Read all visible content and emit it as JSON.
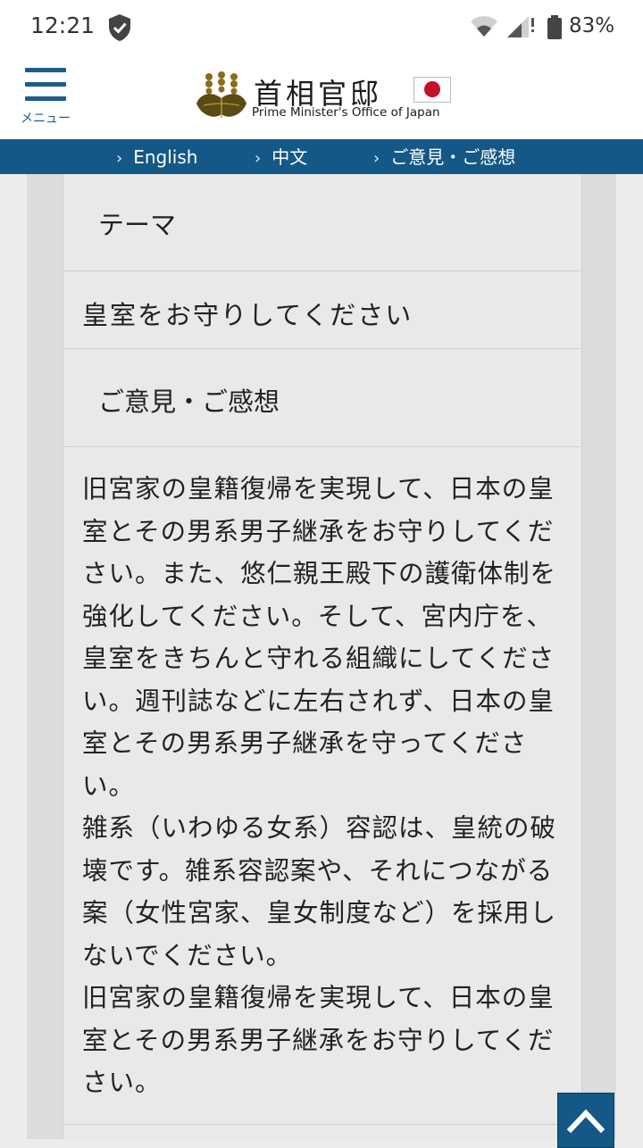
{
  "status_bar": {
    "time": "12:21",
    "battery_percent": "83%"
  },
  "header": {
    "menu_label": "メニュー",
    "site_title_ja": "首相官邸",
    "site_title_en": "Prime Minister's Office of Japan"
  },
  "nav": {
    "items": [
      {
        "label": "English"
      },
      {
        "label": "中文"
      },
      {
        "label": "ご意見・ご感想"
      }
    ]
  },
  "content": {
    "theme_header": "テーマ",
    "theme_value": "皇室をお守りしてください",
    "opinion_header": "ご意見・ご感想",
    "opinion_body": "旧宮家の皇籍復帰を実現して、日本の皇室とその男系男子継承をお守りしてください。また、悠仁親王殿下の護衛体制を強化してください。そして、宮内庁を、皇室をきちんと守れる組織にしてください。週刊誌などに左右されず、日本の皇室とその男系男子継承を守ってください。\n雑系（いわゆる女系）容認は、皇統の破壊です。雑系容認案や、それにつながる案（女性宮家、皇女制度など）を採用しないでください。\n旧宮家の皇籍復帰を実現して、日本の皇室とその男系男子継承をお守りしてください。"
  },
  "colors": {
    "nav_bg": "#135886",
    "accent": "#1d5d8a",
    "flag_red": "#c8102e"
  }
}
